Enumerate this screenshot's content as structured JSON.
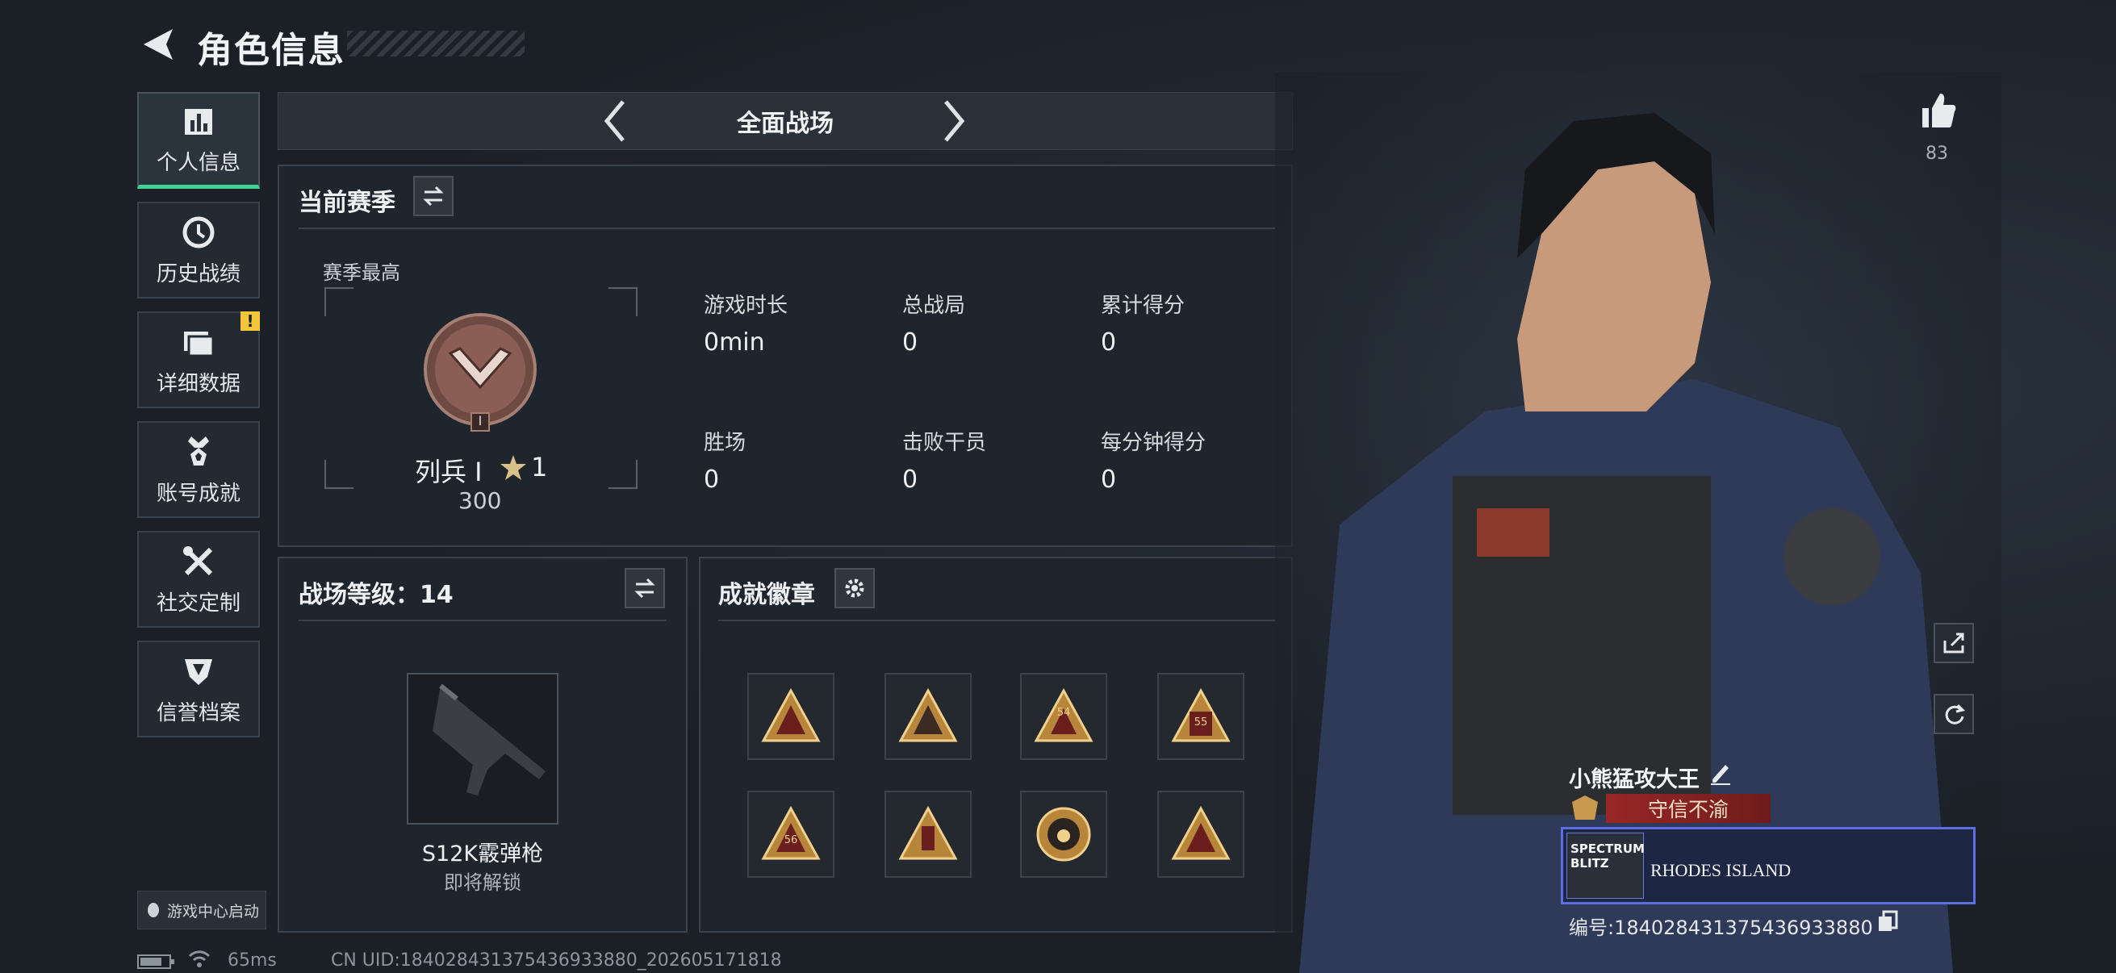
{
  "header": {
    "title": "角色信息"
  },
  "sidebar": {
    "items": [
      {
        "label": "个人信息",
        "icon": "bar-chart-icon",
        "active": true
      },
      {
        "label": "历史战绩",
        "icon": "history-icon"
      },
      {
        "label": "详细数据",
        "icon": "folder-icon",
        "badge": "!"
      },
      {
        "label": "账号成就",
        "icon": "medal-icon"
      },
      {
        "label": "社交定制",
        "icon": "tools-icon"
      },
      {
        "label": "信誉档案",
        "icon": "shield-icon"
      }
    ],
    "game_center_label": "游戏中心启动"
  },
  "mode": {
    "label": "全面战场"
  },
  "season": {
    "title": "当前赛季",
    "best_label": "赛季最高",
    "rank_name": "列兵 Ⅰ",
    "rank_stars": "1",
    "rank_points": "300",
    "rank_roman": "Ⅰ",
    "stats": [
      {
        "label": "游戏时长",
        "value": "0min"
      },
      {
        "label": "总战局",
        "value": "0"
      },
      {
        "label": "累计得分",
        "value": "0"
      },
      {
        "label": "胜场",
        "value": "0"
      },
      {
        "label": "击败干员",
        "value": "0"
      },
      {
        "label": "每分钟得分",
        "value": "0"
      }
    ]
  },
  "battlefield_level": {
    "title": "战场等级：14",
    "weapon_name": "S12K霰弹枪",
    "weapon_status": "即将解锁"
  },
  "achievements": {
    "title": "成就徽章",
    "badges": [
      "54",
      "55",
      "56"
    ]
  },
  "character": {
    "likes": "83",
    "player_name": "小熊猛攻大王",
    "title_text": "守信不渝",
    "banner_left": "SPECTRUM BLITZ",
    "banner_right": "RHODES ISLAND",
    "uid_text": "编号:1840284313754369338​80"
  },
  "status_bar": {
    "ping": "65ms",
    "uid": "CN UID:1840284313754369338​80_202605171818"
  },
  "colors": {
    "accent": "#3fd494",
    "warning": "#f3c53b",
    "title_red": "#9a2626",
    "banner_border": "#5d6fe3"
  }
}
